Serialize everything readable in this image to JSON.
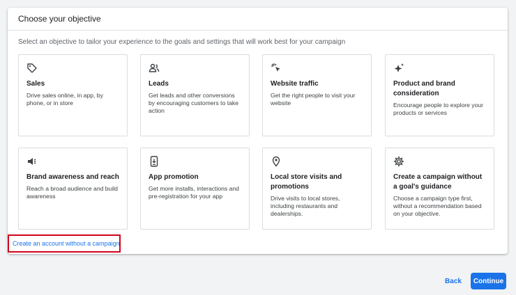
{
  "header": {
    "title": "Choose your objective"
  },
  "intro": "Select an objective to tailor your experience to the goals and settings that will work best for your campaign",
  "objectives": [
    {
      "icon": "tag-icon",
      "title": "Sales",
      "desc": "Drive sales online, in app, by phone, or in store"
    },
    {
      "icon": "people-icon",
      "title": "Leads",
      "desc": "Get leads and other conversions by encouraging customers to take action"
    },
    {
      "icon": "cursor-click-icon",
      "title": "Website traffic",
      "desc": "Get the right people to visit your website"
    },
    {
      "icon": "sparkle-icon",
      "title": "Product and brand consideration",
      "desc": "Encourage people to explore your products or services"
    },
    {
      "icon": "megaphone-icon",
      "title": "Brand awareness and reach",
      "desc": "Reach a broad audience and build awareness"
    },
    {
      "icon": "phone-download-icon",
      "title": "App promotion",
      "desc": "Get more installs, interactions and pre-registration for your app"
    },
    {
      "icon": "location-pin-icon",
      "title": "Local store visits and promotions",
      "desc": "Drive visits to local stores, including restaurants and dealerships."
    },
    {
      "icon": "gear-icon",
      "title": "Create a campaign without a goal's guidance",
      "desc": "Choose a campaign type first, without a recommendation based on your objective."
    }
  ],
  "link": {
    "label": "Create an account without a campaign",
    "highlight_color": "#d0021b"
  },
  "footer": {
    "back_label": "Back",
    "continue_label": "Continue"
  },
  "colors": {
    "accent": "#1a73e8"
  }
}
